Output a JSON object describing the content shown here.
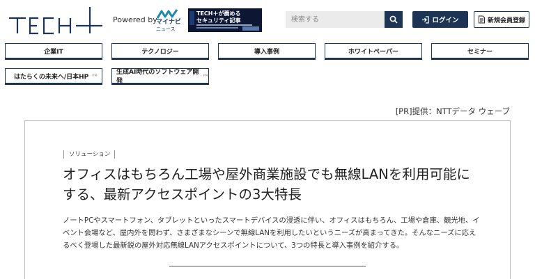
{
  "header": {
    "logo_text": "TECH+",
    "powered_by": "Powered by",
    "partner_logo_line1": "マイナビ",
    "partner_logo_line2": "ニュース",
    "banner_line1": "TECH＋が薦める",
    "banner_line2": "セキュリティ記事",
    "search": {
      "placeholder": "検索する"
    },
    "login_label": "ログイン",
    "register_label": "新規会員登録"
  },
  "nav": {
    "items": [
      {
        "label": "企業IT",
        "pr": ""
      },
      {
        "label": "テクノロジー",
        "pr": ""
      },
      {
        "label": "導入事例",
        "pr": ""
      },
      {
        "label": "ホワイトペーパー",
        "pr": ""
      },
      {
        "label": "セミナー",
        "pr": ""
      },
      {
        "label": "はたらくの未来へ/日本HP",
        "pr": "PR"
      },
      {
        "label": "生成AI時代のソフトウェア開発",
        "pr": "PR"
      }
    ]
  },
  "article": {
    "provider": "[PR]提供：NTTデータ ウェーブ",
    "category": "ソリューション",
    "title": "オフィスはもちろん工場や屋外商業施設でも無線LANを利用可能にする、最新アクセスポイントの3大特長",
    "lead": "ノートPCやスマートフォン、タブレットといったスマートデバイスの浸透に伴い、オフィスはもちろん、工場や倉庫、観光地、イベント会場など、屋内外を問わず、さまざまなシーンで無線LANを利用したいというニーズが高まってきた。そんなニーズに応えるべく登場した最新鋭の屋外対応無線LANアクセスポイントについて、3つの特長と導入事例を紹介する。"
  },
  "colors": {
    "navy": "#1d3455",
    "logo_teal": "#1a8aa8",
    "banner_bg": "#0d1633"
  }
}
